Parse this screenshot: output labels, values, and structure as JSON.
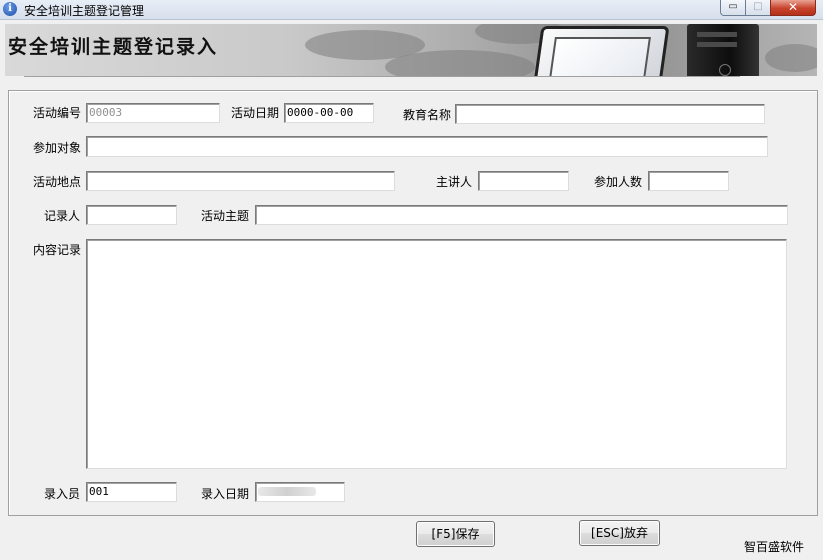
{
  "window": {
    "title": "安全培训主题登记管理",
    "controls": {
      "minimize": "▭",
      "maximize": "□",
      "close": "✕"
    }
  },
  "banner": {
    "heading": "安全培训主题登记录入"
  },
  "form": {
    "activity_no": {
      "label": "活动编号",
      "value": "00003"
    },
    "activity_date": {
      "label": "活动日期",
      "value": "0000-00-00"
    },
    "edu_name": {
      "label": "教育名称",
      "value": ""
    },
    "participants": {
      "label": "参加对象",
      "value": ""
    },
    "location": {
      "label": "活动地点",
      "value": ""
    },
    "speaker": {
      "label": "主讲人",
      "value": ""
    },
    "attendee_count": {
      "label": "参加人数",
      "value": ""
    },
    "recorder": {
      "label": "记录人",
      "value": ""
    },
    "theme": {
      "label": "活动主题",
      "value": ""
    },
    "content": {
      "label": "内容记录",
      "value": ""
    },
    "entry_clerk": {
      "label": "录入员",
      "value": "001"
    },
    "entry_date": {
      "label": "录入日期",
      "value": ""
    }
  },
  "buttons": {
    "save": "[F5]保存",
    "discard": "[ESC]放弃"
  },
  "footer": {
    "brand": "智百盛软件"
  },
  "icons": {
    "app": "info-icon",
    "monitor": "computer-monitor-icon",
    "tower": "computer-tower-icon"
  }
}
